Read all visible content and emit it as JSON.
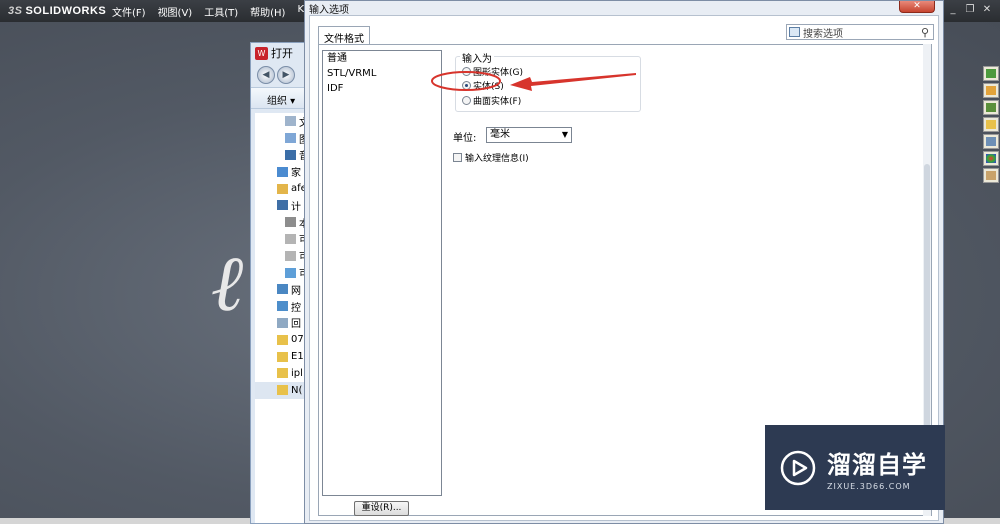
{
  "app": {
    "logo": "SOLIDWORKS",
    "menu": [
      "文件(F)",
      "视图(V)",
      "工具(T)",
      "帮助(H)",
      "KYTool"
    ],
    "window_controls": [
      "_",
      "❐",
      "✕"
    ]
  },
  "open_dialog": {
    "title": "打开",
    "toolbar_label": "组织 ▾",
    "tree_items": [
      "文",
      "图",
      "音",
      "家",
      "afe",
      "计",
      "本",
      "可",
      "可",
      "可",
      "网",
      "控",
      "回",
      "07",
      "E1",
      "ipl",
      "N("
    ]
  },
  "import_dialog": {
    "title": "输入选项",
    "close_label": "✕",
    "tab_label": "文件格式",
    "search_placeholder": "搜索选项",
    "formats": [
      "普通",
      "STL/VRML",
      "IDF"
    ],
    "import_as_label": "输入为",
    "options": [
      {
        "label": "图形实体(G)",
        "selected": false
      },
      {
        "label": "实体(S)",
        "selected": true
      },
      {
        "label": "曲面实体(F)",
        "selected": false
      }
    ],
    "unit_label": "单位:",
    "unit_value": "毫米",
    "texture_label": "输入纹理信息(I)",
    "reset_label": "重设(R)..."
  },
  "watermark": {
    "cn": "溜溜自学",
    "url": "ZIXUE.3D66.COM"
  },
  "colors": {
    "highlight_circle": "#d7342c",
    "arrow": "#d7342c"
  }
}
